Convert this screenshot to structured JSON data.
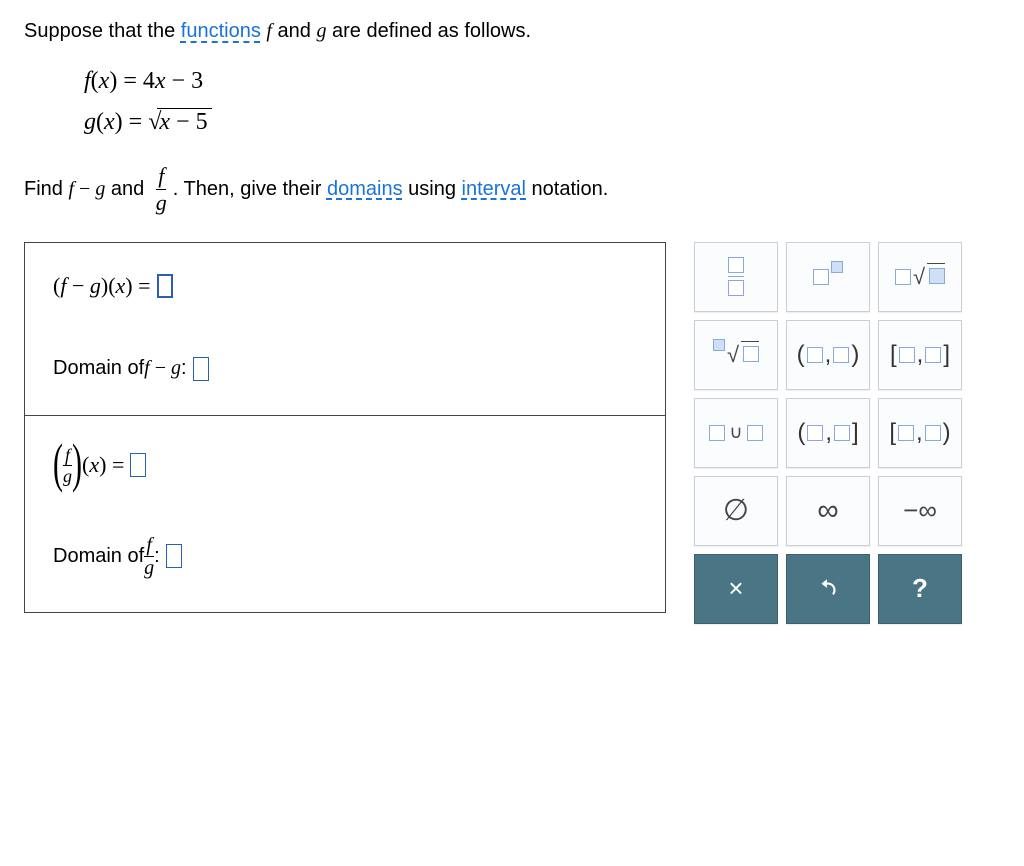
{
  "prompt": {
    "before_link1": "Suppose that the ",
    "link1": "functions",
    "mid1": " ",
    "f": "f",
    "and": " and ",
    "g": "g",
    "after": " are defined as follows."
  },
  "defs": {
    "f_lhs": "f",
    "x": "x",
    "eq": " = ",
    "f_rhs_a": "4",
    "f_rhs_b": "x",
    "f_rhs_c": " − 3",
    "g_lhs": "g",
    "g_rhs_pre": " = ",
    "g_root_arg_a": "x",
    "g_root_arg_b": " − 5"
  },
  "instr": {
    "before": "Find ",
    "fminusg_f": "f",
    "fminusg_mid": " − ",
    "fminusg_g": "g",
    "and": " and ",
    "frac_top": "f",
    "frac_bot": "g",
    "after1": ". Then, give their ",
    "link_domains": "domains",
    "after2": " using ",
    "link_interval": "interval",
    "after3": " notation."
  },
  "answers": {
    "fg_expr_left_open": "(",
    "fg_expr_f": "f",
    "fg_expr_minus": " − ",
    "fg_expr_g": "g",
    "fg_expr_close": ")",
    "fg_expr_x_open": "(",
    "fg_expr_x": "x",
    "fg_expr_x_close": ")",
    "fg_expr_eq": " = ",
    "domain_of": "Domain  of ",
    "colon": " : ",
    "quot_x_open": "(",
    "quot_x": "x",
    "quot_x_close": ")",
    "quot_eq": " = "
  },
  "toolbox": {
    "items": [
      "fraction",
      "exponent",
      "times-sqrt",
      "nth-root",
      "open-interval",
      "closed-interval",
      "union",
      "half-open-left",
      "half-open-right",
      "empty-set",
      "infinity",
      "neg-infinity"
    ],
    "empty_set": "∅",
    "infinity": "∞",
    "neg_infinity": "−∞",
    "close": "×",
    "help": "?"
  }
}
